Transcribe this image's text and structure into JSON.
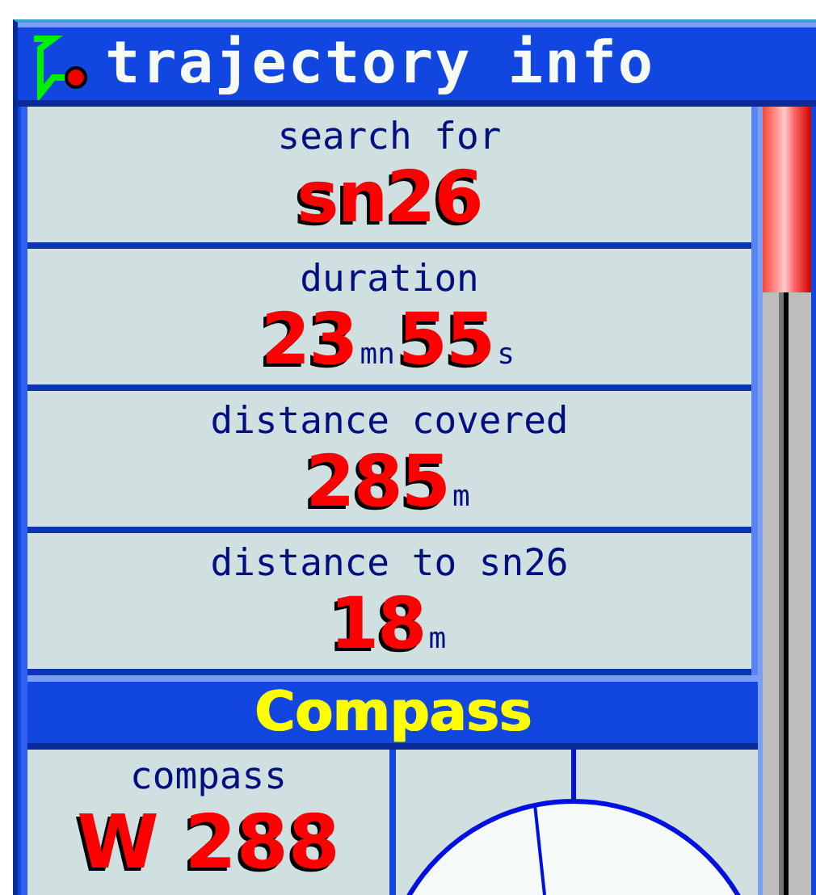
{
  "window": {
    "title": "trajectory info"
  },
  "rows": [
    {
      "label": "search for",
      "value": [
        {
          "kind": "number",
          "text": "sn26"
        }
      ]
    },
    {
      "label": "duration",
      "value": [
        {
          "kind": "number",
          "text": "23"
        },
        {
          "kind": "unit",
          "text": "mn"
        },
        {
          "kind": "number",
          "text": "55"
        },
        {
          "kind": "unit",
          "text": "s"
        }
      ]
    },
    {
      "label": "distance covered",
      "value": [
        {
          "kind": "number",
          "text": "285"
        },
        {
          "kind": "unit",
          "text": "m"
        }
      ]
    },
    {
      "label": "distance to sn26",
      "value": [
        {
          "kind": "number",
          "text": "18"
        },
        {
          "kind": "unit",
          "text": "m"
        }
      ]
    }
  ],
  "compass": {
    "title": "Compass",
    "label": "compass",
    "value": "W 288"
  }
}
